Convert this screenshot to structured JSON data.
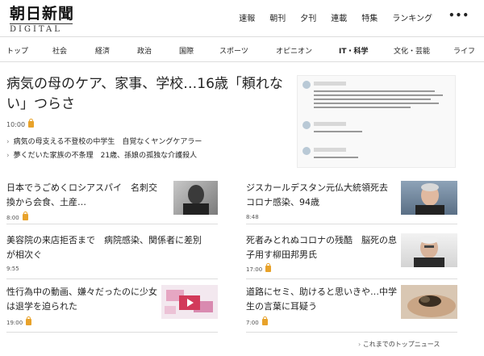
{
  "header": {
    "logo_kanji": "朝日新聞",
    "logo_sub": "DIGITAL",
    "nav": [
      "速報",
      "朝刊",
      "夕刊",
      "連載",
      "特集",
      "ランキング"
    ],
    "more": "•••"
  },
  "categories": [
    "トップ",
    "社会",
    "経済",
    "政治",
    "国際",
    "スポーツ",
    "オピニオン",
    "IT・科学",
    "文化・芸能",
    "ライフ"
  ],
  "lead": {
    "title": "病気の母のケア、家事、学校…16歳「頼れない」つらさ",
    "time": "10:00",
    "related": [
      "病気の母支える不登校の中学生　自覚なくヤングケアラー",
      "夢くだいた家族の不条理　21歳、孫娘の孤独な介護殺人"
    ]
  },
  "articles": [
    {
      "title": "日本でうごめくロシアスパイ　名刺交換から会食、土産…",
      "time": "8:00",
      "locked": true,
      "thumb": "portrait-bw"
    },
    {
      "title": "ジスカールデスタン元仏大統領死去　コロナ感染、94歳",
      "time": "8:48",
      "locked": false,
      "thumb": "portrait-old"
    },
    {
      "title": "美容院の来店拒否まで　病院感染、関係者に差別が相次ぐ",
      "time": "9:55",
      "locked": false,
      "thumb": ""
    },
    {
      "title": "死者みとれぬコロナの残酷　脳死の息子用す柳田邦男氏",
      "time": "17:00",
      "locked": true,
      "thumb": "portrait-glasses"
    },
    {
      "title": "性行為中の動画、嫌々だったのに少女は退学を迫られた",
      "time": "19:00",
      "locked": true,
      "thumb": "illustration-video"
    },
    {
      "title": "道路にセミ、助けると思いきや…中学生の言葉に耳疑う",
      "time": "7:00",
      "locked": true,
      "thumb": "cicada-hand"
    }
  ],
  "more_link": "これまでのトップニュース",
  "icons": {
    "lock": "lock-icon",
    "bullet": "chevron-right-icon"
  }
}
